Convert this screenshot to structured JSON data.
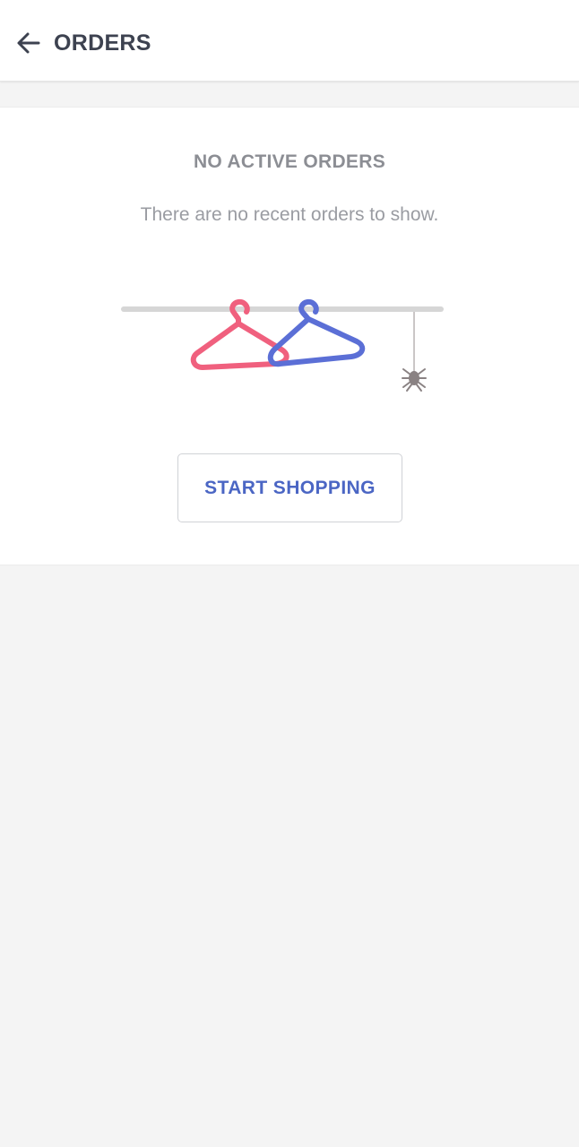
{
  "header": {
    "back_icon": "arrow-left-icon",
    "title": "ORDERS"
  },
  "empty_state": {
    "title": "NO ACTIVE ORDERS",
    "subtitle": "There are no recent orders to show.",
    "illustration": {
      "icons": [
        "clothes-rail-icon",
        "hanger-icon",
        "spider-icon"
      ],
      "colors": {
        "rail": "#d6d6d6",
        "hanger_left": "#f0607e",
        "hanger_right": "#5b6fd6",
        "spider": "#8a8283"
      }
    },
    "button_label": "START SHOPPING"
  },
  "colors": {
    "background": "#f4f4f4",
    "surface": "#ffffff",
    "title_text": "#3d4250",
    "muted_text": "#8c8e94",
    "accent": "#4b66c4"
  }
}
